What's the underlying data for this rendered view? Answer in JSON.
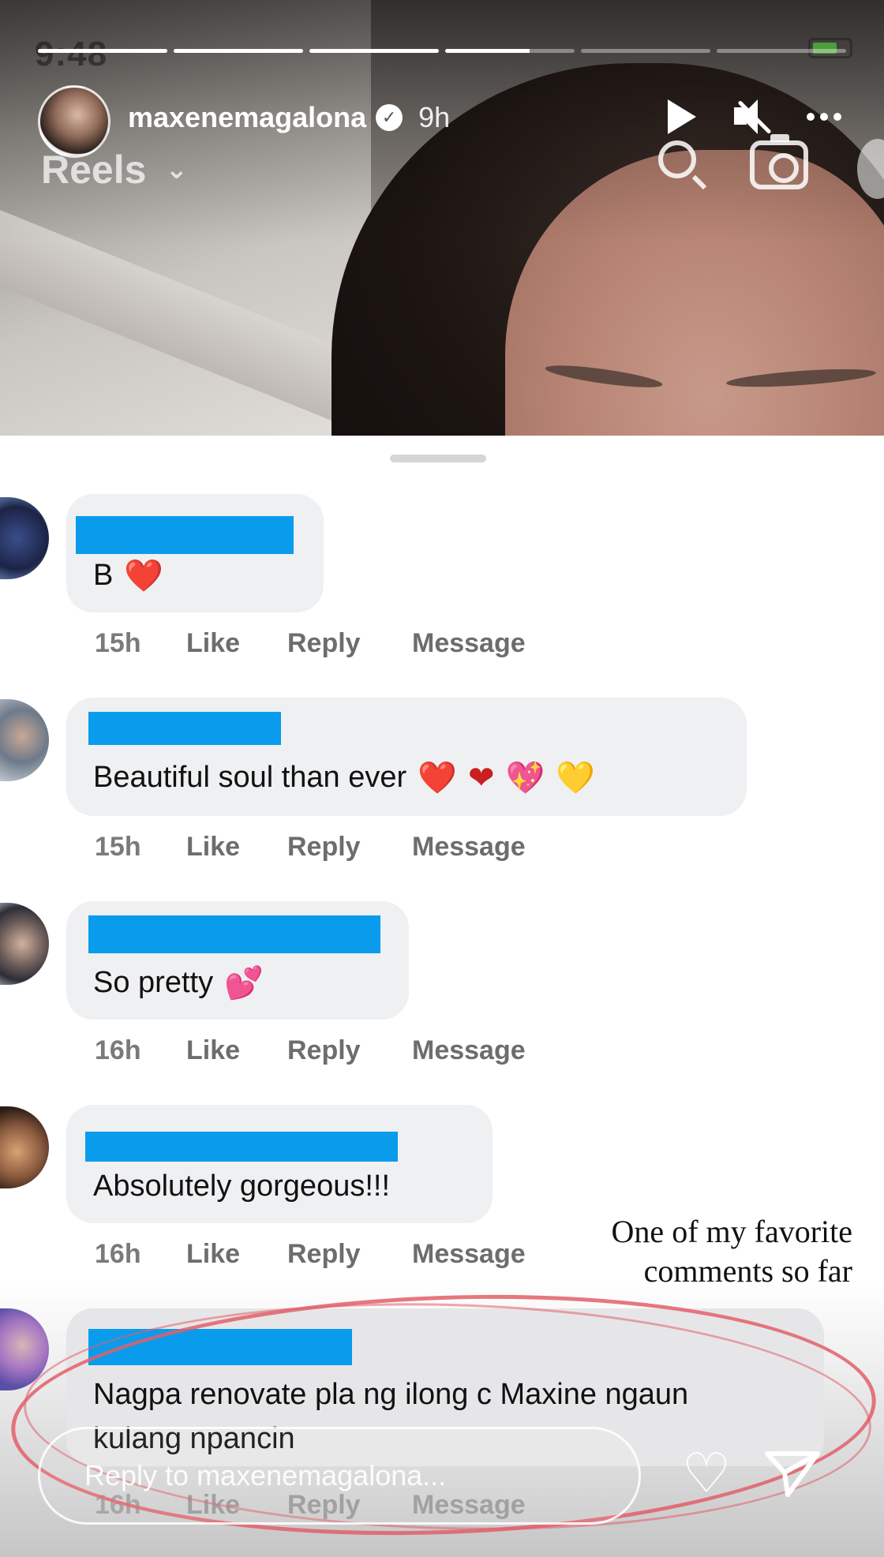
{
  "status_bar": {
    "time": "9:48"
  },
  "story_progress": [
    1.0,
    1.0,
    1.0,
    0.65,
    0.0,
    0.0
  ],
  "header": {
    "username": "maxenemagalona",
    "post_age": "9h",
    "section": "Reels"
  },
  "comments": [
    {
      "text": "B",
      "emojis": [
        "❤️"
      ],
      "time": "15h"
    },
    {
      "text": "Beautiful soul than ever",
      "emojis": [
        "❤️",
        "❤",
        "💖",
        "💛"
      ],
      "time": "15h"
    },
    {
      "text": "So pretty",
      "emojis": [
        "💕"
      ],
      "time": "16h"
    },
    {
      "text": "Absolutely gorgeous!!!",
      "emojis": [],
      "time": "16h"
    },
    {
      "text_line1": "Nagpa renovate pla ng ilong c Maxine ngaun",
      "text_line2": "kulang npancin",
      "time": "16h"
    }
  ],
  "comment_actions": {
    "like": "Like",
    "reply": "Reply",
    "message": "Message"
  },
  "annotation": {
    "line1": "One of my favorite",
    "line2": "comments so far"
  },
  "reply_bar": {
    "placeholder": "Reply to maxenemagalona..."
  },
  "colors": {
    "redaction": "#0a9cec",
    "bubble": "#eff0f2",
    "highlight_circle": "#e25f69"
  },
  "icons": [
    "play-icon",
    "mute-icon",
    "more-icon",
    "search-icon",
    "camera-icon",
    "verified-icon",
    "chevron-down-icon",
    "heart-icon",
    "send-icon"
  ]
}
